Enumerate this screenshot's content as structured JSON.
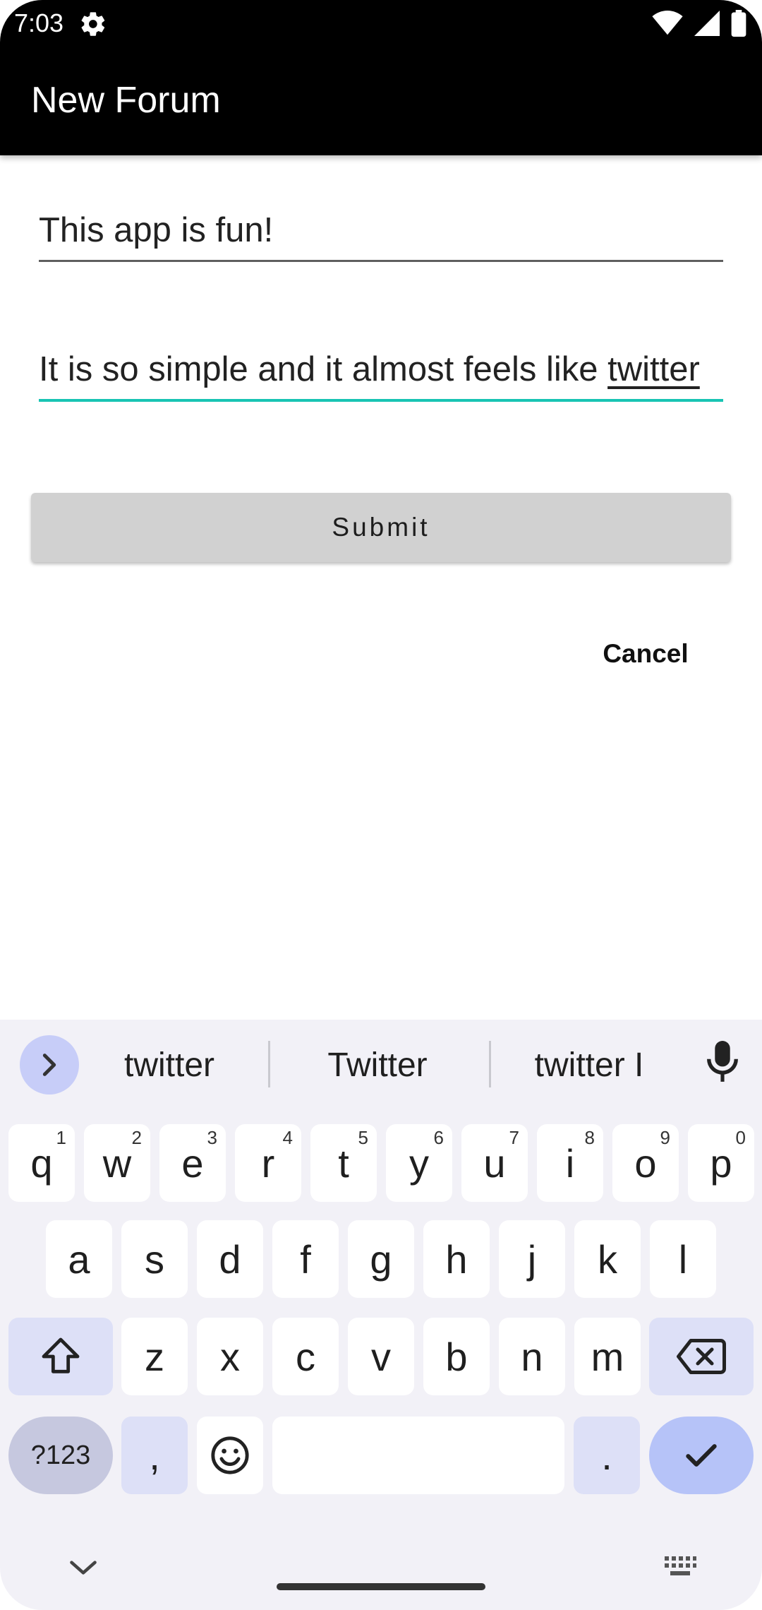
{
  "status_bar": {
    "time": "7:03"
  },
  "toolbar": {
    "title": "New Forum"
  },
  "form": {
    "title_value": "This app is fun!",
    "body_prefix": "It is so simple and it almost feels like ",
    "body_underlined_word": "twitter",
    "submit_label": "Submit",
    "cancel_label": "Cancel",
    "focus_color": "#18c4b3"
  },
  "keyboard": {
    "suggestions": [
      "twitter",
      "Twitter",
      "twitter I"
    ],
    "row1": [
      {
        "key": "q",
        "hint": "1"
      },
      {
        "key": "w",
        "hint": "2"
      },
      {
        "key": "e",
        "hint": "3"
      },
      {
        "key": "r",
        "hint": "4"
      },
      {
        "key": "t",
        "hint": "5"
      },
      {
        "key": "y",
        "hint": "6"
      },
      {
        "key": "u",
        "hint": "7"
      },
      {
        "key": "i",
        "hint": "8"
      },
      {
        "key": "o",
        "hint": "9"
      },
      {
        "key": "p",
        "hint": "0"
      }
    ],
    "row2": [
      "a",
      "s",
      "d",
      "f",
      "g",
      "h",
      "j",
      "k",
      "l"
    ],
    "row3": [
      "z",
      "x",
      "c",
      "v",
      "b",
      "n",
      "m"
    ],
    "symbols_label": "?123",
    "comma_label": ",",
    "period_label": ".",
    "icons": {
      "expand": "chevron-right-icon",
      "mic": "microphone-icon",
      "shift": "shift-icon",
      "backspace": "backspace-icon",
      "emoji": "emoji-icon",
      "enter": "checkmark-icon",
      "hide": "chevron-down-icon",
      "switch": "keyboard-icon"
    }
  }
}
